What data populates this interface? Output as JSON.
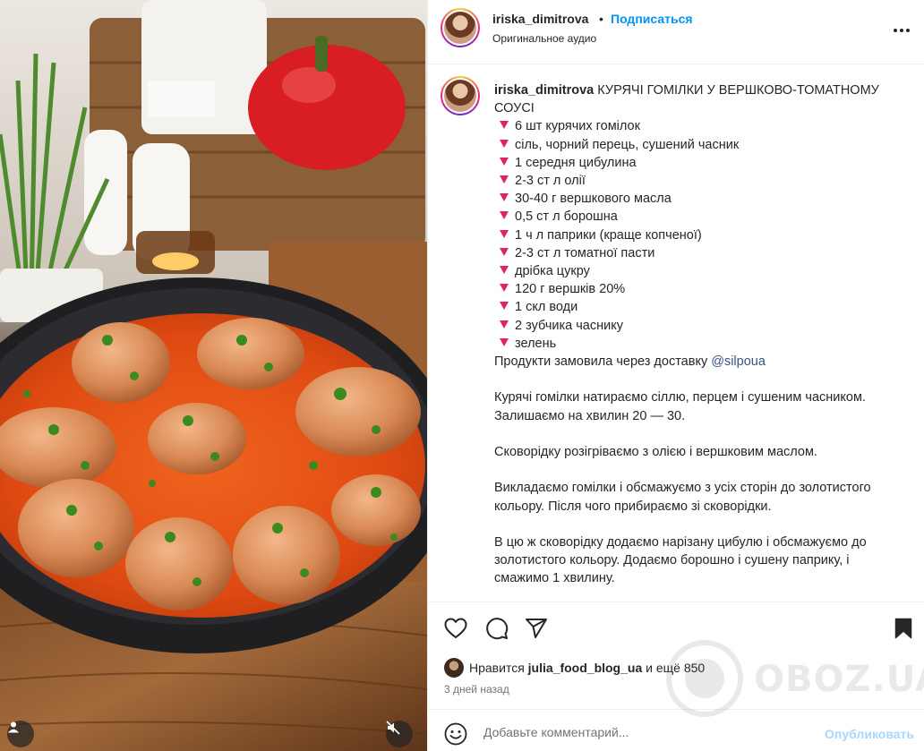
{
  "post": {
    "username": "iriska_dimitrova",
    "separator": "•",
    "follow_label": "Подписаться",
    "audio_label": "Оригинальное аудио",
    "more_icon": "more-horizontal-icon"
  },
  "caption": {
    "username": "iriska_dimitrova",
    "title": "КУРЯЧІ ГОМІЛКИ У ВЕРШКОВО-ТОМАТНОМУ СОУСІ",
    "ingredients": [
      "6 шт курячих гомілок",
      "сіль, чорний перець, сушений часник",
      "1 середня цибулина",
      "2-3 ст л олії",
      "30-40 г вершкового масла",
      "0,5 ст л борошна",
      "1 ч л паприки (краще копченої)",
      "2-3 ст л томатної пасти",
      "дрібка цукру",
      "120 г вершків 20%",
      "1 скл води",
      "2 зубчика часнику",
      "зелень"
    ],
    "delivery_text": "Продукти замовила через доставку",
    "delivery_mention": "@silpoua",
    "paragraphs": [
      "Курячі гомілки натираємо сіллю, перцем і сушеним часником. Залишаємо на хвилин 20 — 30.",
      "Сковорідку розігріваємо з олією і вершковим маслом.",
      "Викладаємо гомілки і обсмажуємо з усіх сторін до золотистого кольору. Після чого прибираємо зі сковорідки.",
      "В цю ж сковорідку додаємо нарізану цибулю і обсмажуємо до золотистого кольору. Додаємо борошно і сушену паприку, і смажимо 1 хвилину."
    ]
  },
  "actions": {
    "icons": [
      "heart-icon",
      "comment-icon",
      "share-icon",
      "bookmark-icon"
    ],
    "likes_prefix": "Нравится",
    "likes_user": "julia_food_blog_ua",
    "likes_suffix": "и ещё 850",
    "date": "3 дней назад"
  },
  "comment": {
    "placeholder": "Добавьте комментарий...",
    "post_label": "Опубликовать"
  },
  "watermark": {
    "text": "OBOZ.UA"
  },
  "colors": {
    "link_blue": "#0095f6",
    "post_disabled": "#a8d8fb",
    "list_marker": "#e0245e",
    "mention": "#385185"
  }
}
